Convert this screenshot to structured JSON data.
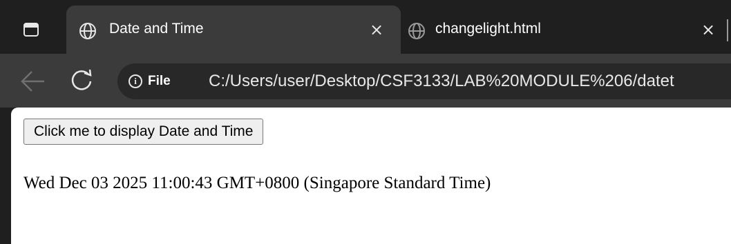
{
  "browser": {
    "tabs": [
      {
        "title": "Date and Time",
        "icon": "globe-icon",
        "active": true,
        "close_glyph": "×"
      },
      {
        "title": "changelight.html",
        "icon": "globe-icon",
        "active": false,
        "close_glyph": "×"
      }
    ],
    "toolbar": {
      "back_icon": "back-arrow-icon",
      "reload_icon": "reload-icon"
    },
    "omnibox": {
      "info_icon_glyph": "i",
      "scheme_label": "File",
      "url": "C:/Users/user/Desktop/CSF3133/LAB%20MODULE%206/datet"
    }
  },
  "page": {
    "button_label": "Click me to display Date and Time",
    "datetime_text": "Wed Dec 03 2025 11:00:43 GMT+0800 (Singapore Standard Time)"
  },
  "colors": {
    "chrome_dark": "#1f1f1f",
    "chrome_toolbar": "#3b3b3b",
    "omnibox_bg": "#282828",
    "page_bg": "#ffffff"
  }
}
